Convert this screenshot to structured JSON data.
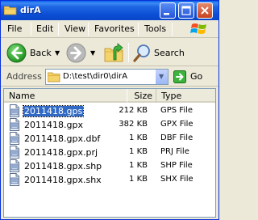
{
  "window": {
    "title": "dirA"
  },
  "menu": {
    "items": [
      "File",
      "Edit",
      "View",
      "Favorites",
      "Tools"
    ]
  },
  "toolbar": {
    "back_label": "Back",
    "search_label": "Search"
  },
  "address": {
    "label": "Address",
    "value": "D:\\test\\dir0\\dirA",
    "go_label": "Go"
  },
  "filelist": {
    "columns": [
      "Name",
      "Size",
      "Type"
    ],
    "rows": [
      {
        "name": "2011418.gps",
        "size": "212 KB",
        "type": "GPS File",
        "icon": "file-icon",
        "selected": true
      },
      {
        "name": "2011418.gpx",
        "size": "382 KB",
        "type": "GPX File",
        "icon": "file-icon",
        "selected": false
      },
      {
        "name": "2011418.gpx.dbf",
        "size": "1 KB",
        "type": "DBF File",
        "icon": "file-icon",
        "selected": false
      },
      {
        "name": "2011418.gpx.prj",
        "size": "1 KB",
        "type": "PRJ File",
        "icon": "file-icon",
        "selected": false
      },
      {
        "name": "2011418.gpx.shp",
        "size": "1 KB",
        "type": "SHP File",
        "icon": "file-icon",
        "selected": false
      },
      {
        "name": "2011418.gpx.shx",
        "size": "1 KB",
        "type": "SHX File",
        "icon": "file-icon",
        "selected": false
      }
    ]
  },
  "colors": {
    "titlebar": "#0A46C8",
    "selection": "#316AC5",
    "chrome": "#ECE9D8"
  }
}
